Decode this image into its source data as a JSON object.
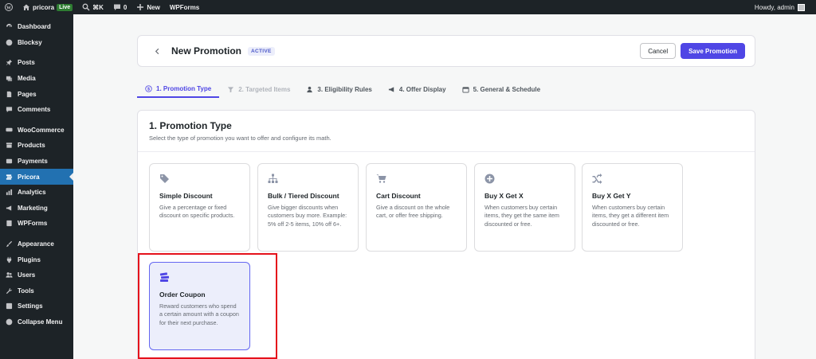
{
  "adminbar": {
    "site_name": "pricora",
    "live_badge": "Live",
    "shortcut": "⌘K",
    "comments_count": "0",
    "new_label": "New",
    "wpforms_label": "WPForms",
    "howdy": "Howdy, admin"
  },
  "sidebar": {
    "items": [
      {
        "label": "Dashboard",
        "icon": "dashboard-icon"
      },
      {
        "label": "Blocksy",
        "icon": "blocksy-icon"
      },
      {
        "label": "Posts",
        "icon": "pin-icon"
      },
      {
        "label": "Media",
        "icon": "media-icon"
      },
      {
        "label": "Pages",
        "icon": "page-icon"
      },
      {
        "label": "Comments",
        "icon": "comment-icon"
      },
      {
        "label": "WooCommerce",
        "icon": "woo-icon"
      },
      {
        "label": "Products",
        "icon": "archive-icon"
      },
      {
        "label": "Payments",
        "icon": "payments-icon"
      },
      {
        "label": "Pricora",
        "icon": "pricora-icon"
      },
      {
        "label": "Analytics",
        "icon": "chart-icon"
      },
      {
        "label": "Marketing",
        "icon": "megaphone-icon"
      },
      {
        "label": "WPForms",
        "icon": "forms-icon"
      },
      {
        "label": "Appearance",
        "icon": "brush-icon"
      },
      {
        "label": "Plugins",
        "icon": "plugin-icon"
      },
      {
        "label": "Users",
        "icon": "users-icon"
      },
      {
        "label": "Tools",
        "icon": "wrench-icon"
      },
      {
        "label": "Settings",
        "icon": "settings-icon"
      },
      {
        "label": "Collapse Menu",
        "icon": "collapse-icon"
      }
    ]
  },
  "header": {
    "title": "New Promotion",
    "status": "ACTIVE",
    "cancel_label": "Cancel",
    "save_label": "Save Promotion"
  },
  "tabs": [
    {
      "label": "1. Promotion Type",
      "icon": "dollar-icon",
      "state": "active"
    },
    {
      "label": "2. Targeted Items",
      "icon": "filter-icon",
      "state": "disabled"
    },
    {
      "label": "3. Eligibility Rules",
      "icon": "user-icon",
      "state": "normal"
    },
    {
      "label": "4. Offer Display",
      "icon": "megaphone-icon",
      "state": "normal"
    },
    {
      "label": "5. General & Schedule",
      "icon": "calendar-icon",
      "state": "normal"
    }
  ],
  "section": {
    "title": "1. Promotion Type",
    "description": "Select the type of promotion you want to offer and configure its math."
  },
  "promotion_types": [
    {
      "title": "Simple Discount",
      "description": "Give a percentage or fixed discount on specific products.",
      "icon": "tag-icon",
      "selected": false
    },
    {
      "title": "Bulk / Tiered Discount",
      "description": "Give bigger discounts when customers buy more. Example: 5% off 2-5 items, 10% off 6+.",
      "icon": "sitemap-icon",
      "selected": false
    },
    {
      "title": "Cart Discount",
      "description": "Give a discount on the whole cart, or offer free shipping.",
      "icon": "cart-icon",
      "selected": false
    },
    {
      "title": "Buy X Get X",
      "description": "When customers buy certain items, they get the same item discounted or free.",
      "icon": "plus-circle-icon",
      "selected": false
    },
    {
      "title": "Buy X Get Y",
      "description": "When customers buy certain items, they get a different item discounted or free.",
      "icon": "shuffle-icon",
      "selected": false
    },
    {
      "title": "Order Coupon",
      "description": "Reward customers who spend a certain amount with a coupon for their next purchase.",
      "icon": "coupon-stack-icon",
      "selected": true
    }
  ],
  "colors": {
    "accent": "#4f46e5",
    "admin_dark": "#1d2327",
    "admin_blue": "#2271b1",
    "live_green": "#2e7d32",
    "highlight_red": "#e5111b"
  }
}
